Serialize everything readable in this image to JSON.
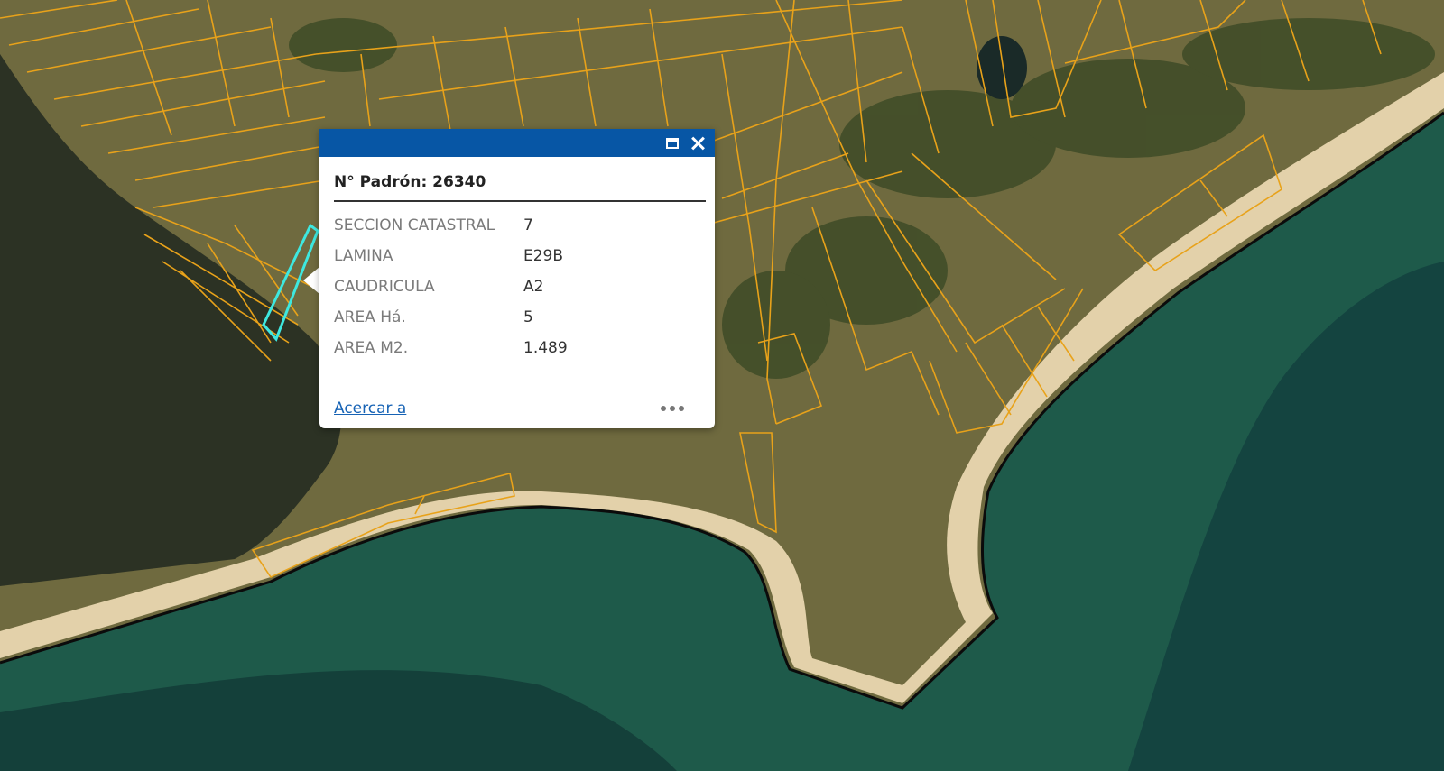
{
  "map": {
    "colors": {
      "land": "#6f6a3f",
      "vegetation": "#3e4b27",
      "sea": "#1e5a4a",
      "deep_sea": "#103a3c",
      "lagoon": "#2c3224",
      "sand": "#e3d1aa",
      "parcel_outline": "#e8a21a",
      "selected_parcel": "#3ee8e0",
      "coastline": "#0b0b0b"
    }
  },
  "popup": {
    "title": "N° Padrón: 26340",
    "header_color": "#0756a5",
    "buttons": {
      "maximize_icon": "maximize-icon",
      "close_icon": "close-icon"
    },
    "fields": [
      {
        "name": "SECCION CATASTRAL",
        "value": "7"
      },
      {
        "name": "LAMINA",
        "value": "E29B"
      },
      {
        "name": "CAUDRICULA",
        "value": "A2"
      },
      {
        "name": "AREA Há.",
        "value": "5"
      },
      {
        "name": "AREA M2.",
        "value": "1.489"
      }
    ],
    "zoom_link": "Acercar a",
    "more_icon": "more-dots-icon"
  }
}
